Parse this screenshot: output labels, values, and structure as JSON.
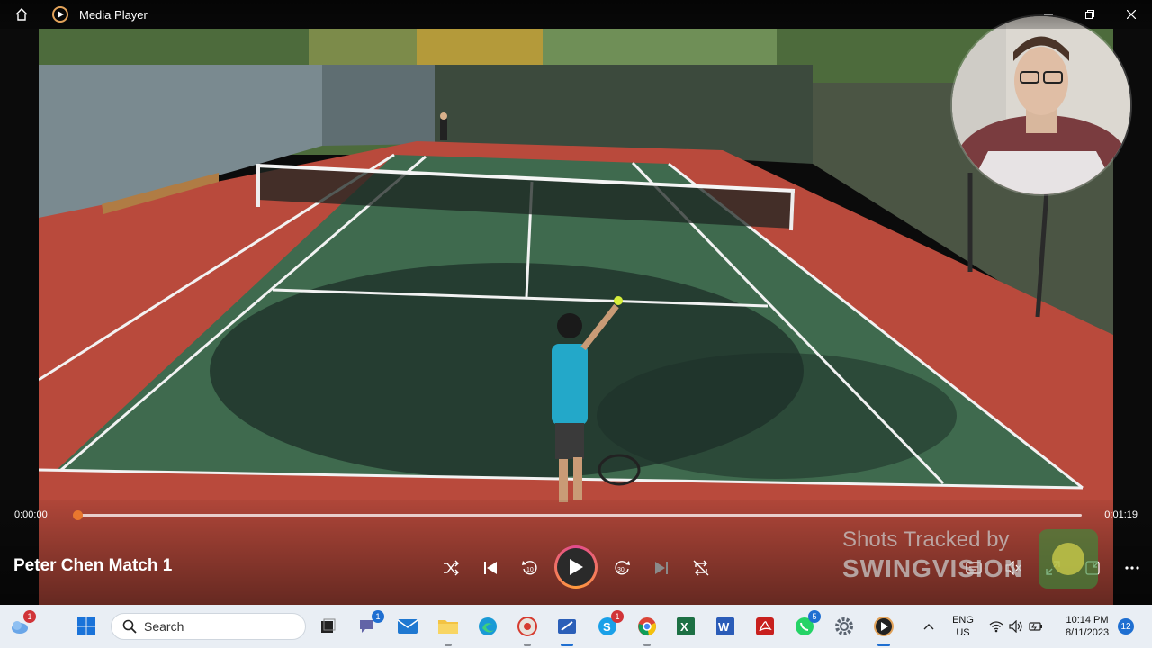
{
  "window": {
    "title": "Media Player"
  },
  "player": {
    "media_title": "Peter Chen Match 1",
    "current_time": "0:00:00",
    "total_time": "0:01:19",
    "progress": 0.0,
    "accent_color": "#e8772e"
  },
  "watermark": {
    "line1": "Shots Tracked by",
    "line2": "SWINGVISION"
  },
  "taskbar": {
    "search_placeholder": "Search",
    "language": "ENG",
    "region": "US",
    "time": "10:14 PM",
    "date": "8/11/2023",
    "notification_count": "12",
    "badges": {
      "weather": "1",
      "teams": "1",
      "skype": "1",
      "whatsapp": "5"
    }
  }
}
